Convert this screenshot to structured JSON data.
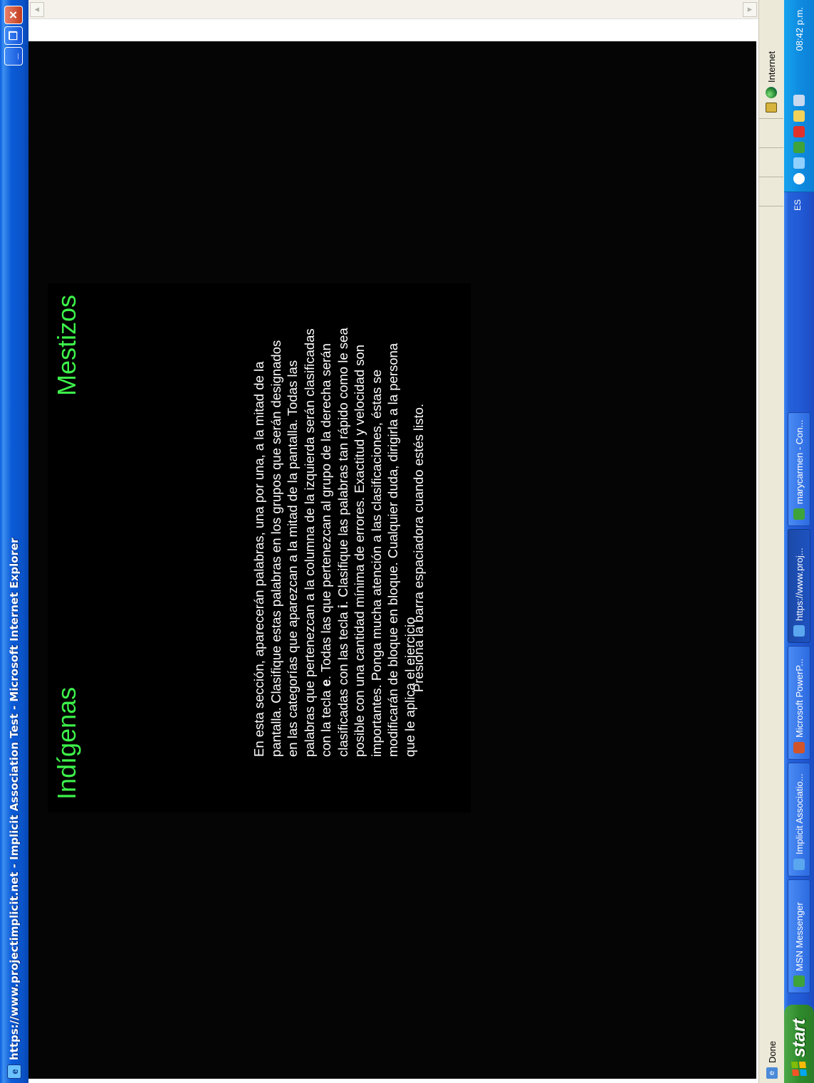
{
  "window": {
    "title": "https://www.projectimplicit.net - Implicit Association Test - Microsoft Internet Explorer",
    "minimize": "_",
    "restore": "❐",
    "close": "✕"
  },
  "iat": {
    "left_category": "Indígenas",
    "right_category": "Mestizos",
    "instructions_parts": [
      "En esta sección, aparecerán palabras, una por una, a la mitad de la pantalla. Clasifique estas palabras en los grupos que serán designados en las categorías que aparezcan a la mitad de la pantalla. Todas las palabras que pertenezcan a la columna de la izquierda serán clasificadas con la tecla ",
      "e",
      ". Todas las que pertenezcan al grupo de la derecha serán clasificadas con las tecla ",
      "i",
      ". Clasifique las palabras tan rápido como le sea posible con una cantidad mínima de errores. Exactitud y velocidad son importantes. Ponga mucha atención a las clasificaciones, éstas se modificarán de bloque en bloque. Cualquier duda, dirigirla a la persona que le aplica el ejercicio"
    ],
    "prompt": "Presiona la barra espaciadora cuando estés listo."
  },
  "statusbar": {
    "status_text": "Done",
    "zone": "Internet"
  },
  "taskbar": {
    "start_label": "start",
    "tasks": [
      {
        "label": "MSN Messenger",
        "icon": "msn-icon",
        "color": "#3da33a"
      },
      {
        "label": "Implicit Associatio...",
        "icon": "ie-icon",
        "color": "#5aa7f0"
      },
      {
        "label": "Microsoft PowerP...",
        "icon": "powerpoint-icon",
        "color": "#d2542a"
      },
      {
        "label": "https://www.proj...",
        "icon": "ie-icon",
        "color": "#5aa7f0"
      },
      {
        "label": "marycarmen - Con...",
        "icon": "messenger-contact-icon",
        "color": "#3da33a"
      }
    ],
    "language": "ES",
    "clock": "08:42 p.m."
  },
  "colors": {
    "category_text": "#3df24a",
    "page_background": "#050505",
    "instruction_text": "#ffffff"
  }
}
